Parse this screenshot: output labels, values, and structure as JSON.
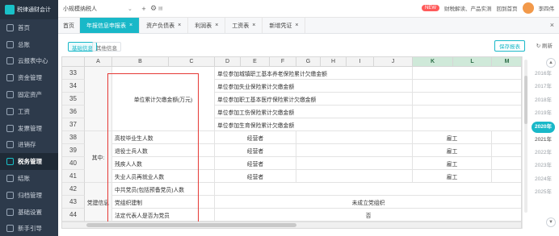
{
  "app": {
    "logo_text": "税律通财会计",
    "company": "小规模纳税人"
  },
  "sidebar": {
    "items": [
      {
        "label": "首页",
        "icon": "home-icon"
      },
      {
        "label": "总账",
        "icon": "ledger-icon"
      },
      {
        "label": "云报表中心",
        "icon": "chart-icon"
      },
      {
        "label": "资金管理",
        "icon": "wallet-icon"
      },
      {
        "label": "固定资产",
        "icon": "asset-icon"
      },
      {
        "label": "工资",
        "icon": "salary-icon"
      },
      {
        "label": "发票管理",
        "icon": "invoice-icon"
      },
      {
        "label": "进销存",
        "icon": "box-icon"
      },
      {
        "label": "税务管理",
        "icon": "tax-icon",
        "active": true
      },
      {
        "label": "结账",
        "icon": "lock-icon"
      },
      {
        "label": "归档管理",
        "icon": "archive-icon"
      },
      {
        "label": "基础设置",
        "icon": "gear-icon"
      },
      {
        "label": "新手引导",
        "icon": "guide-icon"
      }
    ]
  },
  "topbar": {
    "new_badge": "NEW",
    "menu_text": "财税解读、产品实测",
    "home_link": "回到首页",
    "user_name": "李四伟"
  },
  "tabs": [
    {
      "label": "首页"
    },
    {
      "label": "年报信息申报表",
      "active": true
    },
    {
      "label": "资产负债表"
    },
    {
      "label": "利润表"
    },
    {
      "label": "工资表"
    },
    {
      "label": "新增凭证"
    }
  ],
  "subtabs": [
    "基础信息",
    "其他信息"
  ],
  "buttons": {
    "save": "保存报表",
    "refresh": "刷新"
  },
  "grid": {
    "columns": [
      "A",
      "B",
      "C",
      "D",
      "E",
      "F",
      "G",
      "H",
      "I",
      "J",
      "K",
      "L",
      "M"
    ],
    "selected_columns": [
      "K",
      "L",
      "M"
    ],
    "rows": [
      "33",
      "34",
      "35",
      "36",
      "37",
      "38",
      "39",
      "40",
      "41",
      "42",
      "43",
      "44"
    ],
    "labels": {
      "unit_total": "单位累计欠缴金额(万元)",
      "r33": "单位参加城镇职工基本养老保险累计欠缴金额",
      "r34": "单位参加失业保险累计欠缴金额",
      "r35": "单位参加职工基本医疗保险累计欠缴金额",
      "r36": "单位参加工伤保险累计欠缴金额",
      "r37": "单位参加生育保险累计欠缴金额",
      "r38": "高校毕业生人数",
      "r39": "退役士兵人数",
      "r40": "残疾人人数",
      "r41": "失业人员再就业人数",
      "r42": "中共党员(包括预备党员)人数",
      "r43": "党组织建制",
      "r44": "法定代表人是否为党员",
      "qizhong": "其中:",
      "dangjian": "党建信息",
      "jingyingzhe": "经营者",
      "yuangong": "雇工",
      "r43_value": "未成立党组织",
      "r44_value": "否"
    }
  },
  "years": [
    "2016年",
    "2017年",
    "2018年",
    "2019年",
    "2020年",
    "2021年",
    "2022年",
    "2023年",
    "2024年",
    "2025年"
  ],
  "current_year": "2020年"
}
